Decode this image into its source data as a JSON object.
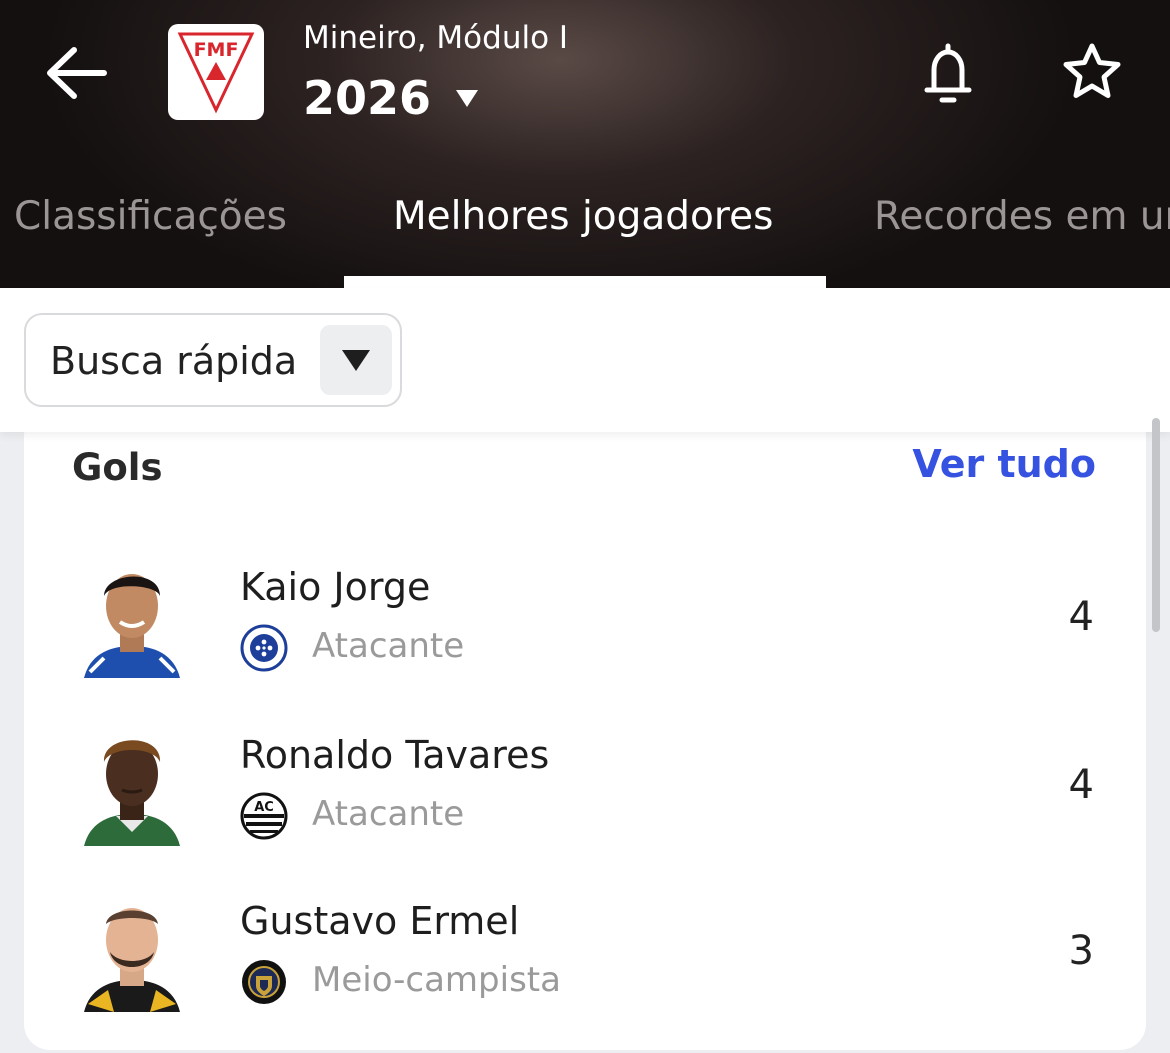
{
  "header": {
    "competition_name": "Mineiro, Módulo I",
    "season": "2026",
    "logo_text": "FMF",
    "icons": {
      "back": "back-arrow-icon",
      "season_dropdown": "caret-down-icon",
      "notifications": "bell-icon",
      "favorite": "star-icon"
    }
  },
  "tabs": [
    {
      "label": "Classificações",
      "active": false
    },
    {
      "label": "Melhores jogadores",
      "active": true
    },
    {
      "label": "Recordes em um",
      "active": false
    }
  ],
  "filter": {
    "label": "Busca rápida"
  },
  "top_scorers": {
    "title": "Gols",
    "see_all_label": "Ver tudo",
    "players": [
      {
        "name": "Kaio Jorge",
        "position": "Atacante",
        "team_crest": "cruzeiro-crest",
        "value": "4"
      },
      {
        "name": "Ronaldo Tavares",
        "position": "Atacante",
        "team_crest": "athletic-crest",
        "value": "4"
      },
      {
        "name": "Gustavo Ermel",
        "position": "Meio-campista",
        "team_crest": "north-esporte-clube-crest",
        "value": "3"
      }
    ]
  },
  "colors": {
    "accent_link": "#3652e0",
    "header_bg": "#1a1414",
    "tab_inactive": "#9c9595",
    "tab_active": "#ffffff",
    "logo_red": "#d9262c"
  }
}
